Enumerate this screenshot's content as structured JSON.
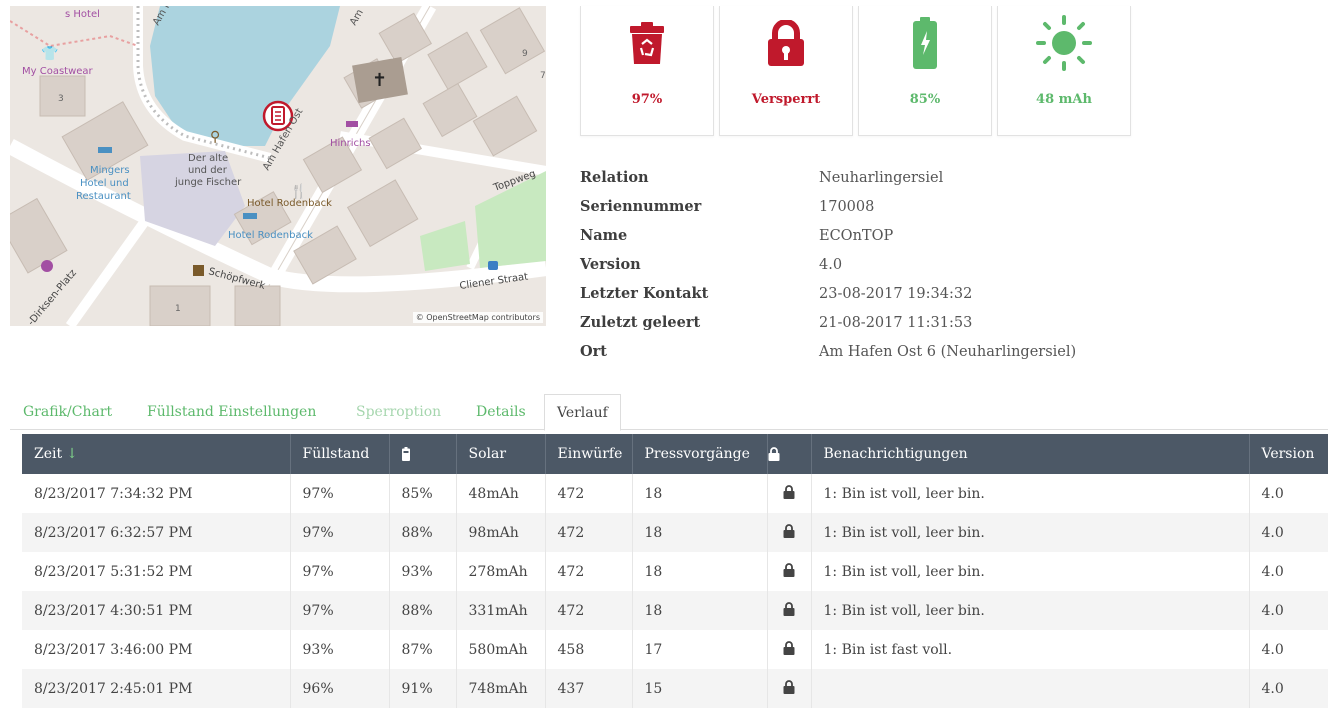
{
  "map": {
    "attribution": "© OpenStreetMap contributors",
    "labels": {
      "hotel_top": "s Hotel",
      "am_top": "Am H",
      "am_top2": "Am",
      "coastwear": "My Coastwear",
      "house3": "3",
      "house9": "9",
      "house7": "7",
      "am_hafen_ost": "Am Hafen Ost",
      "hinrichs": "Hinrichs",
      "mingers1": "Mingers",
      "mingers2": "Hotel und",
      "mingers3": "Restaurant",
      "fischer1": "Der alte",
      "fischer2": "und der",
      "fischer3": "junge Fischer",
      "rodenback1": "Hotel Rodenback",
      "rodenback2": "Hotel Rodenback",
      "toppweg": "Toppweg",
      "schoepfwerk": "Schöpfwerk",
      "cliener": "Cliener Straat",
      "dirksen": "-Dirksen-Platz",
      "house1": "1"
    }
  },
  "tiles": [
    {
      "icon": "recycling-bin-icon",
      "value": "97%",
      "color": "#c0192c"
    },
    {
      "icon": "lock-icon",
      "value": "Versperrt",
      "color": "#c0192c"
    },
    {
      "icon": "battery-icon",
      "value": "85%",
      "color": "#5db96c"
    },
    {
      "icon": "sun-icon",
      "value": "48 mAh",
      "color": "#5db96c"
    }
  ],
  "details": [
    {
      "key": "Relation",
      "value": "Neuharlingersiel"
    },
    {
      "key": "Seriennummer",
      "value": "170008"
    },
    {
      "key": "Name",
      "value": "ECOnTOP"
    },
    {
      "key": "Version",
      "value": "4.0"
    },
    {
      "key": "Letzter Kontakt",
      "value": "23-08-2017 19:34:32"
    },
    {
      "key": "Zuletzt geleert",
      "value": "21-08-2017 11:31:53"
    },
    {
      "key": "Ort",
      "value": "Am Hafen Ost 6 (Neuharlingersiel)"
    }
  ],
  "tabs": [
    {
      "label": "Grafik/Chart",
      "state": "normal"
    },
    {
      "label": "Füllstand Einstellungen",
      "state": "normal"
    },
    {
      "label": "Sperroption",
      "state": "muted"
    },
    {
      "label": "Details",
      "state": "normal"
    },
    {
      "label": "Verlauf",
      "state": "active"
    }
  ],
  "table": {
    "headers": {
      "zeit": "Zeit",
      "sort_arrow": "↓",
      "fuellstand": "Füllstand",
      "battery_icon": "battery-icon",
      "solar": "Solar",
      "einwuerfe": "Einwürfe",
      "pressvorgaenge": "Pressvorgänge",
      "lock_icon": "lock-icon",
      "benachrichtigungen": "Benachrichtigungen",
      "version": "Version"
    },
    "rows": [
      {
        "zeit": "8/23/2017 7:34:32 PM",
        "fuellstand": "97%",
        "battery": "85%",
        "solar": "48mAh",
        "einwuerfe": "472",
        "press": "18",
        "notify": "1: Bin ist voll, leer bin.",
        "version": "4.0"
      },
      {
        "zeit": "8/23/2017 6:32:57 PM",
        "fuellstand": "97%",
        "battery": "88%",
        "solar": "98mAh",
        "einwuerfe": "472",
        "press": "18",
        "notify": "1: Bin ist voll, leer bin.",
        "version": "4.0"
      },
      {
        "zeit": "8/23/2017 5:31:52 PM",
        "fuellstand": "97%",
        "battery": "93%",
        "solar": "278mAh",
        "einwuerfe": "472",
        "press": "18",
        "notify": "1: Bin ist voll, leer bin.",
        "version": "4.0"
      },
      {
        "zeit": "8/23/2017 4:30:51 PM",
        "fuellstand": "97%",
        "battery": "88%",
        "solar": "331mAh",
        "einwuerfe": "472",
        "press": "18",
        "notify": "1: Bin ist voll, leer bin.",
        "version": "4.0"
      },
      {
        "zeit": "8/23/2017 3:46:00 PM",
        "fuellstand": "93%",
        "battery": "87%",
        "solar": "580mAh",
        "einwuerfe": "458",
        "press": "17",
        "notify": "1: Bin ist fast voll.",
        "version": "4.0"
      },
      {
        "zeit": "8/23/2017 2:45:01 PM",
        "fuellstand": "96%",
        "battery": "91%",
        "solar": "748mAh",
        "einwuerfe": "437",
        "press": "15",
        "notify": "",
        "version": "4.0"
      }
    ]
  },
  "colors": {
    "accent_green": "#5db96c",
    "alert_red": "#c0192c",
    "table_header": "#4c5866"
  }
}
